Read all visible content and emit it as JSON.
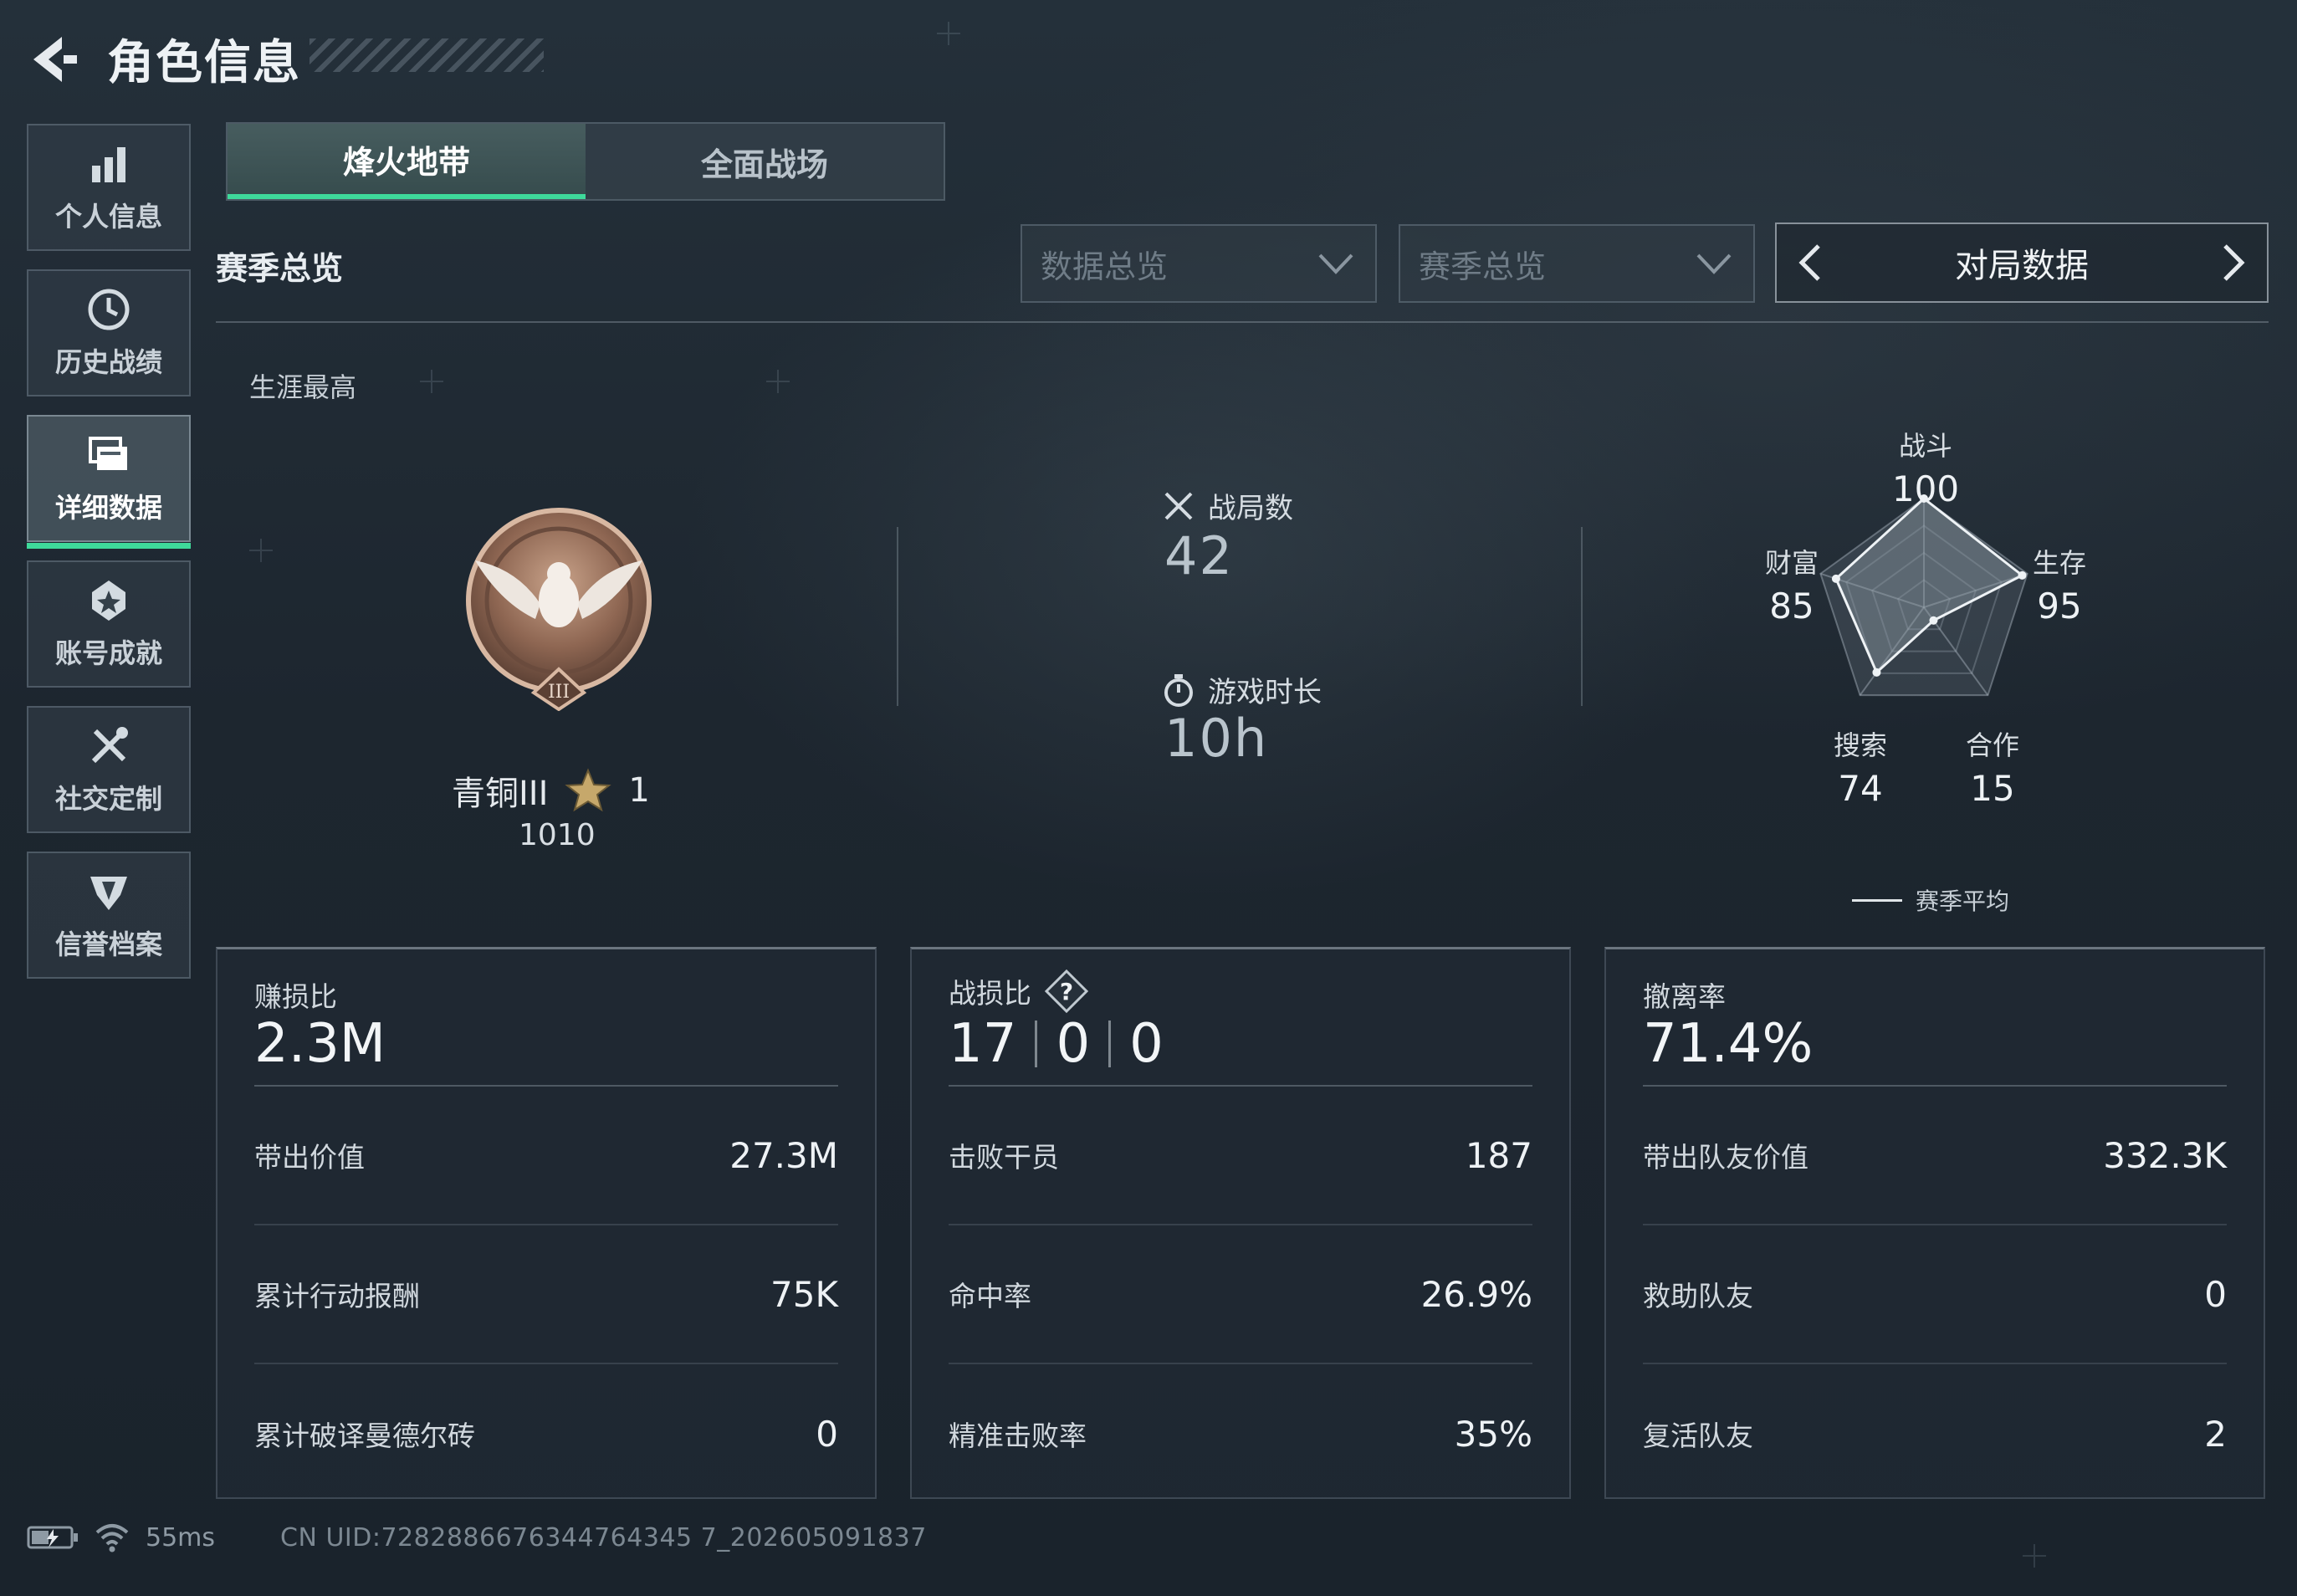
{
  "header": {
    "title": "角色信息",
    "back_icon": "back-arrow-icon"
  },
  "sidebar": {
    "items": [
      {
        "label": "个人信息",
        "icon": "bar-chart-icon",
        "active": false
      },
      {
        "label": "历史战绩",
        "icon": "clock-history-icon",
        "active": false
      },
      {
        "label": "详细数据",
        "icon": "data-cards-icon",
        "active": true
      },
      {
        "label": "账号成就",
        "icon": "achievement-badge-icon",
        "active": false
      },
      {
        "label": "社交定制",
        "icon": "tools-icon",
        "active": false
      },
      {
        "label": "信誉档案",
        "icon": "reputation-shield-icon",
        "active": false
      }
    ]
  },
  "tabs": [
    {
      "label": "烽火地带",
      "active": true
    },
    {
      "label": "全面战场",
      "active": false
    }
  ],
  "section": {
    "title": "赛季总览",
    "dropdown_data": "数据总览",
    "dropdown_season": "赛季总览",
    "pager_label": "对局数据"
  },
  "career": {
    "label": "生涯最高",
    "rank_name": "青铜III",
    "rank_stars": "1",
    "rank_score": "1010"
  },
  "match": {
    "battles_label": "战局数",
    "battles_value": "42",
    "playtime_label": "游戏时长",
    "playtime_value": "10h"
  },
  "radar": {
    "axes": [
      {
        "name": "战斗",
        "value": "100"
      },
      {
        "name": "生存",
        "value": "95"
      },
      {
        "name": "合作",
        "value": "15"
      },
      {
        "name": "搜索",
        "value": "74"
      },
      {
        "name": "财富",
        "value": "85"
      }
    ],
    "scores": [
      100,
      95,
      15,
      74,
      85
    ],
    "legend": "赛季平均"
  },
  "cards": {
    "profit": {
      "head_label": "赚损比",
      "head_value": "2.3M",
      "rows": [
        {
          "label": "带出价值",
          "value": "27.3M"
        },
        {
          "label": "累计行动报酬",
          "value": "75K"
        },
        {
          "label": "累计破译曼德尔砖",
          "value": "0"
        }
      ]
    },
    "combat": {
      "head_label": "战损比",
      "kd": [
        "17",
        "0",
        "0"
      ],
      "rows": [
        {
          "label": "击败干员",
          "value": "187"
        },
        {
          "label": "命中率",
          "value": "26.9%"
        },
        {
          "label": "精准击败率",
          "value": "35%"
        }
      ]
    },
    "extract": {
      "head_label": "撤离率",
      "head_value": "71.4%",
      "rows": [
        {
          "label": "带出队友价值",
          "value": "332.3K"
        },
        {
          "label": "救助队友",
          "value": "0"
        },
        {
          "label": "复活队友",
          "value": "2"
        }
      ]
    }
  },
  "footer": {
    "ping": "55ms",
    "uid": "CN UID:7282886676344764345 7_202605091837"
  },
  "colors": {
    "accent": "#3ed99a",
    "text": "#e6eaee",
    "muted": "#6f7c87"
  }
}
